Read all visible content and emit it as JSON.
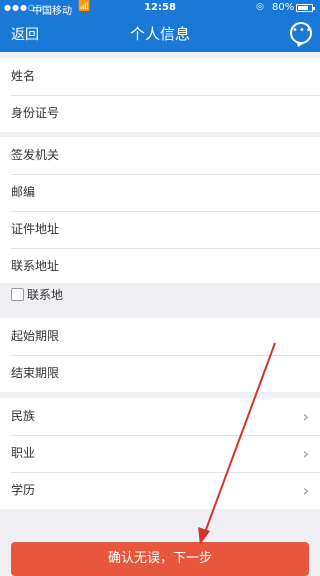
{
  "status_bar": {
    "signal": "●●●○○",
    "carrier": "中国移动",
    "time": "12:58",
    "battery": "80%",
    "battery_level": 0.8
  },
  "navbar": {
    "back_label": "返回",
    "title": "个人信息"
  },
  "section_basic": [
    {
      "label": "姓名",
      "value": ""
    },
    {
      "label": "身份证号",
      "value": ""
    }
  ],
  "section_address": [
    {
      "label": "签发机关",
      "value": ""
    },
    {
      "label": "邮编",
      "value": ""
    },
    {
      "label": "证件地址",
      "value": ""
    },
    {
      "label": "联系地址",
      "value": ""
    }
  ],
  "same_address_checkbox": {
    "label": "联系地",
    "checked": false
  },
  "section_validity": [
    {
      "label": "起始期限"
    },
    {
      "label": "结束期限"
    }
  ],
  "section_select": [
    {
      "label": "民族",
      "chevron": "›"
    },
    {
      "label": "职业",
      "chevron": "›"
    },
    {
      "label": "学历",
      "chevron": "›"
    }
  ],
  "confirm_button": {
    "label": "确认无误，下一步"
  },
  "colors": {
    "primary_blue": "#1a78d6",
    "confirm_red": "#e8573c",
    "annotation_arrow": "#d8332a"
  }
}
